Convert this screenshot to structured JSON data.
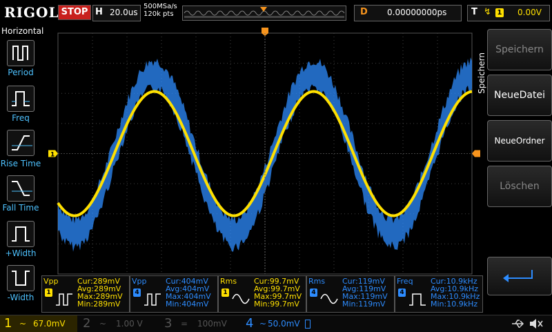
{
  "top": {
    "logo": "RIGOL",
    "run_state": "STOP",
    "horizontal_letter": "H",
    "timebase": "20.0us",
    "sample_rate": "500MSa/s",
    "memory_depth": "120k pts",
    "delay_letter": "D",
    "delay": "0.00000000ps",
    "trigger_letter": "T",
    "trigger_source": "1",
    "trigger_level": "0.00V"
  },
  "left_menu": {
    "title": "Horizontal",
    "items": [
      {
        "label": "Period"
      },
      {
        "label": "Freq"
      },
      {
        "label": "Rise Time"
      },
      {
        "label": "Fall Time"
      },
      {
        "label": "+Width"
      },
      {
        "label": "-Width"
      }
    ]
  },
  "right_menu": {
    "title": "Speichern",
    "buttons": [
      {
        "label": "Speichern",
        "enabled": false
      },
      {
        "label": "NeueDatei",
        "enabled": true
      },
      {
        "label": "NeueOrdner",
        "enabled": true
      },
      {
        "label": "Löschen",
        "enabled": false
      }
    ]
  },
  "screen": {
    "ch1_marker": "1",
    "trigger_pos_marker": "T"
  },
  "measurements": [
    {
      "name": "Vpp",
      "channel": "1",
      "cur": "Cur:289mV",
      "avg": "Avg:289mV",
      "max": "Max:289mV",
      "min": "Min:289mV"
    },
    {
      "name": "Vpp",
      "channel": "4",
      "cur": "Cur:404mV",
      "avg": "Avg:404mV",
      "max": "Max:404mV",
      "min": "Min:404mV"
    },
    {
      "name": "Rms",
      "channel": "1",
      "cur": "Cur:99.7mV",
      "avg": "Avg:99.7mV",
      "max": "Max:99.7mV",
      "min": "Min:99.7mV"
    },
    {
      "name": "Rms",
      "channel": "4",
      "cur": "Cur:119mV",
      "avg": "Avg:119mV",
      "max": "Max:119mV",
      "min": "Min:119mV"
    },
    {
      "name": "Freq",
      "channel": "4",
      "cur": "Cur:10.9kHz",
      "avg": "Avg:10.9kHz",
      "max": "Max:10.9kHz",
      "min": "Min:10.9kHz"
    }
  ],
  "channels": [
    {
      "num": "1",
      "coupling": "~",
      "scale": "67.0mV",
      "active": true
    },
    {
      "num": "2",
      "coupling": "~",
      "scale": "1.00 V",
      "active": false
    },
    {
      "num": "3",
      "coupling": "=",
      "scale": "100mV",
      "active": false
    },
    {
      "num": "4",
      "coupling": "~",
      "scale": "50.0mV",
      "active": true
    }
  ],
  "colors": {
    "ch1": "#ffe000",
    "ch4": "#2d8cff",
    "stop": "#c8201d",
    "trigger": "#f7941d"
  }
}
